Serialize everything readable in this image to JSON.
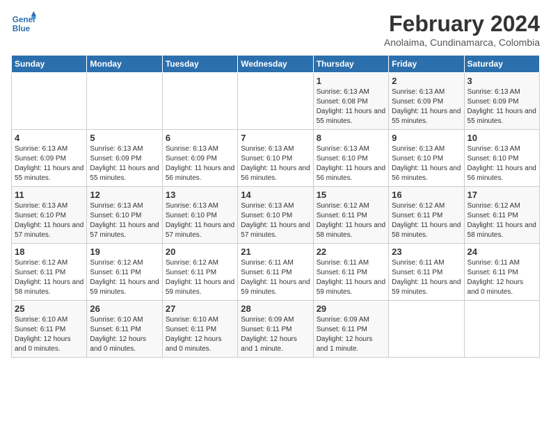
{
  "header": {
    "logo_general": "General",
    "logo_blue": "Blue",
    "month_year": "February 2024",
    "location": "Anolaima, Cundinamarca, Colombia"
  },
  "days_of_week": [
    "Sunday",
    "Monday",
    "Tuesday",
    "Wednesday",
    "Thursday",
    "Friday",
    "Saturday"
  ],
  "weeks": [
    [
      {
        "day": "",
        "info": ""
      },
      {
        "day": "",
        "info": ""
      },
      {
        "day": "",
        "info": ""
      },
      {
        "day": "",
        "info": ""
      },
      {
        "day": "1",
        "info": "Sunrise: 6:13 AM\nSunset: 6:08 PM\nDaylight: 11 hours and 55 minutes."
      },
      {
        "day": "2",
        "info": "Sunrise: 6:13 AM\nSunset: 6:09 PM\nDaylight: 11 hours and 55 minutes."
      },
      {
        "day": "3",
        "info": "Sunrise: 6:13 AM\nSunset: 6:09 PM\nDaylight: 11 hours and 55 minutes."
      }
    ],
    [
      {
        "day": "4",
        "info": "Sunrise: 6:13 AM\nSunset: 6:09 PM\nDaylight: 11 hours and 55 minutes."
      },
      {
        "day": "5",
        "info": "Sunrise: 6:13 AM\nSunset: 6:09 PM\nDaylight: 11 hours and 55 minutes."
      },
      {
        "day": "6",
        "info": "Sunrise: 6:13 AM\nSunset: 6:09 PM\nDaylight: 11 hours and 56 minutes."
      },
      {
        "day": "7",
        "info": "Sunrise: 6:13 AM\nSunset: 6:10 PM\nDaylight: 11 hours and 56 minutes."
      },
      {
        "day": "8",
        "info": "Sunrise: 6:13 AM\nSunset: 6:10 PM\nDaylight: 11 hours and 56 minutes."
      },
      {
        "day": "9",
        "info": "Sunrise: 6:13 AM\nSunset: 6:10 PM\nDaylight: 11 hours and 56 minutes."
      },
      {
        "day": "10",
        "info": "Sunrise: 6:13 AM\nSunset: 6:10 PM\nDaylight: 11 hours and 56 minutes."
      }
    ],
    [
      {
        "day": "11",
        "info": "Sunrise: 6:13 AM\nSunset: 6:10 PM\nDaylight: 11 hours and 57 minutes."
      },
      {
        "day": "12",
        "info": "Sunrise: 6:13 AM\nSunset: 6:10 PM\nDaylight: 11 hours and 57 minutes."
      },
      {
        "day": "13",
        "info": "Sunrise: 6:13 AM\nSunset: 6:10 PM\nDaylight: 11 hours and 57 minutes."
      },
      {
        "day": "14",
        "info": "Sunrise: 6:13 AM\nSunset: 6:10 PM\nDaylight: 11 hours and 57 minutes."
      },
      {
        "day": "15",
        "info": "Sunrise: 6:12 AM\nSunset: 6:11 PM\nDaylight: 11 hours and 58 minutes."
      },
      {
        "day": "16",
        "info": "Sunrise: 6:12 AM\nSunset: 6:11 PM\nDaylight: 11 hours and 58 minutes."
      },
      {
        "day": "17",
        "info": "Sunrise: 6:12 AM\nSunset: 6:11 PM\nDaylight: 11 hours and 58 minutes."
      }
    ],
    [
      {
        "day": "18",
        "info": "Sunrise: 6:12 AM\nSunset: 6:11 PM\nDaylight: 11 hours and 58 minutes."
      },
      {
        "day": "19",
        "info": "Sunrise: 6:12 AM\nSunset: 6:11 PM\nDaylight: 11 hours and 59 minutes."
      },
      {
        "day": "20",
        "info": "Sunrise: 6:12 AM\nSunset: 6:11 PM\nDaylight: 11 hours and 59 minutes."
      },
      {
        "day": "21",
        "info": "Sunrise: 6:11 AM\nSunset: 6:11 PM\nDaylight: 11 hours and 59 minutes."
      },
      {
        "day": "22",
        "info": "Sunrise: 6:11 AM\nSunset: 6:11 PM\nDaylight: 11 hours and 59 minutes."
      },
      {
        "day": "23",
        "info": "Sunrise: 6:11 AM\nSunset: 6:11 PM\nDaylight: 11 hours and 59 minutes."
      },
      {
        "day": "24",
        "info": "Sunrise: 6:11 AM\nSunset: 6:11 PM\nDaylight: 12 hours and 0 minutes."
      }
    ],
    [
      {
        "day": "25",
        "info": "Sunrise: 6:10 AM\nSunset: 6:11 PM\nDaylight: 12 hours and 0 minutes."
      },
      {
        "day": "26",
        "info": "Sunrise: 6:10 AM\nSunset: 6:11 PM\nDaylight: 12 hours and 0 minutes."
      },
      {
        "day": "27",
        "info": "Sunrise: 6:10 AM\nSunset: 6:11 PM\nDaylight: 12 hours and 0 minutes."
      },
      {
        "day": "28",
        "info": "Sunrise: 6:09 AM\nSunset: 6:11 PM\nDaylight: 12 hours and 1 minute."
      },
      {
        "day": "29",
        "info": "Sunrise: 6:09 AM\nSunset: 6:11 PM\nDaylight: 12 hours and 1 minute."
      },
      {
        "day": "",
        "info": ""
      },
      {
        "day": "",
        "info": ""
      }
    ]
  ]
}
